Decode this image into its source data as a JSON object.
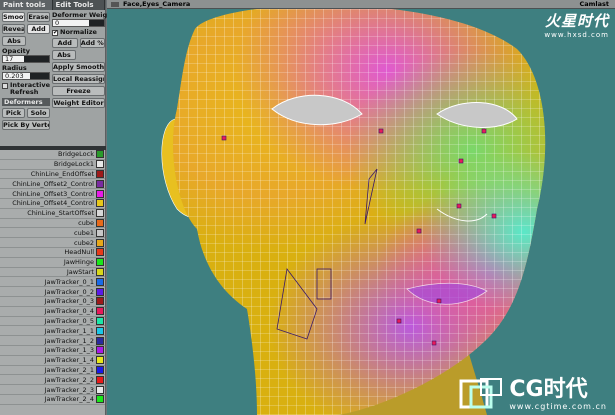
{
  "tabs": [
    "Paint tools",
    "Edit Tools"
  ],
  "left_col": {
    "smooth": "Smooth",
    "erase": "Erase",
    "reveal": "Reveal",
    "add": "Add",
    "abs": "Abs",
    "opacity_label": "Opacity",
    "opacity_value": "17",
    "radius_label": "Radius",
    "radius_value": "0.203",
    "interactive_refresh": "Interactive Refresh",
    "deformers": "Deformers",
    "pick": "Pick",
    "solo": "Solo",
    "pick_by_vertex": "Pick By Vertex"
  },
  "right_col": {
    "deformer_weight_label": "Deformer Weight",
    "deformer_weight_value": "0",
    "normalize": "Normalize",
    "add": "Add",
    "add_pct": "Add %",
    "abs": "Abs",
    "apply_smooth": "Apply Smooth",
    "local_reassign": "Local Reassign",
    "freeze": "Freeze",
    "weight_editor": "Weight Editor"
  },
  "nodes": [
    {
      "name": "BridgeLock",
      "color": "#2a9a2a"
    },
    {
      "name": "BridgeLock1",
      "color": "#e8e8e8"
    },
    {
      "name": "ChinLine_EndOffset",
      "color": "#9e1a1a"
    },
    {
      "name": "ChinLine_Offset2_Control",
      "color": "#7a2aa0"
    },
    {
      "name": "ChinLine_Offset3_Control",
      "color": "#e81ae8"
    },
    {
      "name": "ChinLine_Offset4_Control",
      "color": "#e8c81a"
    },
    {
      "name": "ChinLine_StartOffset",
      "color": "#d8d8d8"
    },
    {
      "name": "cube",
      "color": "#e86a1a"
    },
    {
      "name": "cube1",
      "color": "#c8c8c8"
    },
    {
      "name": "cube2",
      "color": "#e8a81a"
    },
    {
      "name": "HeadNull",
      "color": "#e83a1a"
    },
    {
      "name": "JawHinge",
      "color": "#1ae81a"
    },
    {
      "name": "JawStart",
      "color": "#d8d81a"
    },
    {
      "name": "JawTracker_0_1",
      "color": "#1a6ae8"
    },
    {
      "name": "JawTracker_0_2",
      "color": "#5a1ae8"
    },
    {
      "name": "JawTracker_0_3",
      "color": "#9e1a1a"
    },
    {
      "name": "JawTracker_0_4",
      "color": "#e81a5a"
    },
    {
      "name": "JawTracker_0_5",
      "color": "#1ae8a8"
    },
    {
      "name": "JawTracker_1_1",
      "color": "#1ac8e8"
    },
    {
      "name": "JawTracker_1_2",
      "color": "#2a2a9e"
    },
    {
      "name": "JawTracker_1_3",
      "color": "#a81ae8"
    },
    {
      "name": "JawTracker_1_4",
      "color": "#e8e81a"
    },
    {
      "name": "JawTracker_2_1",
      "color": "#1a1ae8"
    },
    {
      "name": "JawTracker_2_2",
      "color": "#e81a1a"
    },
    {
      "name": "JawTracker_2_3",
      "color": "#e8e8e8"
    },
    {
      "name": "JawTracker_2_4",
      "color": "#1ae81a"
    }
  ],
  "viewport": {
    "title": "Face,Eyes_Camera",
    "camera": "Camlast"
  },
  "watermark_top": {
    "brand": "火星时代",
    "url": "www.hxsd.com"
  },
  "watermark_bottom": {
    "brand": "CG时代",
    "url": "www.cgtime.com.cn"
  }
}
